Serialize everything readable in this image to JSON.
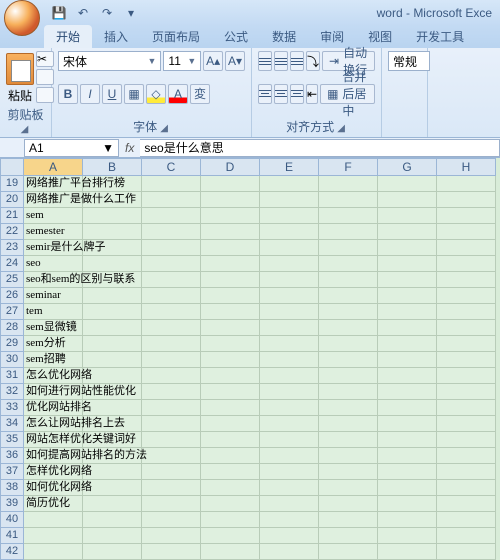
{
  "app": {
    "title": "word - Microsoft Exce"
  },
  "tabs": [
    "开始",
    "插入",
    "页面布局",
    "公式",
    "数据",
    "审阅",
    "视图",
    "开发工具"
  ],
  "activeTab": 0,
  "ribbon": {
    "clipboard": {
      "paste": "粘贴",
      "label": "剪贴板"
    },
    "font": {
      "name": "宋体",
      "size": "11",
      "label": "字体"
    },
    "align": {
      "wrap": "自动换行",
      "merge": "合并后居中",
      "label": "对齐方式"
    },
    "number": {
      "general": "常规"
    }
  },
  "namebox": "A1",
  "formula": "seo是什么意思",
  "columns": [
    "A",
    "B",
    "C",
    "D",
    "E",
    "F",
    "G",
    "H"
  ],
  "rows": [
    {
      "n": 19,
      "a": "网络推广平台排行榜"
    },
    {
      "n": 20,
      "a": "网络推广是做什么工作"
    },
    {
      "n": 21,
      "a": "sem"
    },
    {
      "n": 22,
      "a": "semester"
    },
    {
      "n": 23,
      "a": "semir是什么牌子"
    },
    {
      "n": 24,
      "a": "seo"
    },
    {
      "n": 25,
      "a": "seo和sem的区别与联系"
    },
    {
      "n": 26,
      "a": "seminar"
    },
    {
      "n": 27,
      "a": "tem"
    },
    {
      "n": 28,
      "a": "sem显微镜"
    },
    {
      "n": 29,
      "a": "sem分析"
    },
    {
      "n": 30,
      "a": "sem招聘"
    },
    {
      "n": 31,
      "a": "怎么优化网络"
    },
    {
      "n": 32,
      "a": "如何进行网站性能优化"
    },
    {
      "n": 33,
      "a": "优化网站排名"
    },
    {
      "n": 34,
      "a": "怎么让网站排名上去"
    },
    {
      "n": 35,
      "a": "网站怎样优化关键词好"
    },
    {
      "n": 36,
      "a": "如何提高网站排名的方法"
    },
    {
      "n": 37,
      "a": "怎样优化网络"
    },
    {
      "n": 38,
      "a": "如何优化网络"
    },
    {
      "n": 39,
      "a": "简历优化"
    },
    {
      "n": 40,
      "a": ""
    },
    {
      "n": 41,
      "a": ""
    },
    {
      "n": 42,
      "a": ""
    }
  ]
}
